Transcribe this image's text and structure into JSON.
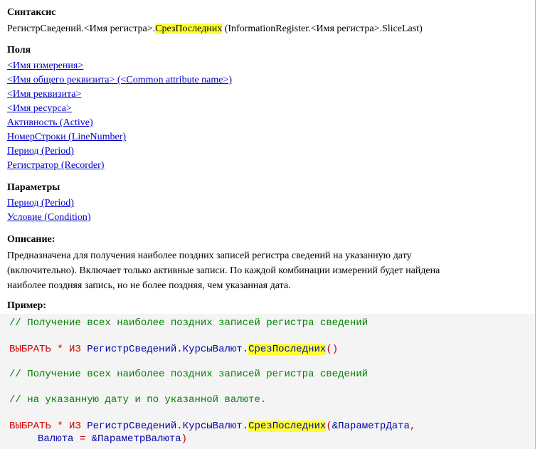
{
  "syntax": {
    "heading": "Синтаксис",
    "prefix": "РегистрСведений.<Имя регистра>.",
    "method": "СрезПоследних",
    "suffix": " (InformationRegister.<Имя регистра>.SliceLast)"
  },
  "fields": {
    "heading": "Поля",
    "items": [
      "<Имя измерения>",
      "<Имя общего реквизита> (<Common attribute name>)",
      "<Имя реквизита>",
      "<Имя ресурса>",
      "Активность (Active)",
      "НомерСтроки (LineNumber)",
      "Период (Period)",
      "Регистратор (Recorder)"
    ]
  },
  "params": {
    "heading": "Параметры",
    "items": [
      "Период (Period)",
      "Условие (Condition)"
    ]
  },
  "description": {
    "heading": "Описание:",
    "line1": "Предназначена для получения наиболее поздних записей регистра сведений на указанную дату",
    "line2": "(включительно). Включает только активные записи. По каждой комбинации измерений будет найдена",
    "line3": "наиболее поздняя запись, но не более поздняя, чем указанная дата."
  },
  "example": {
    "heading": "Пример:",
    "comment1": "// Получение всех наиболее поздних записей регистра сведений",
    "q1_kw": "ВЫБРАТЬ",
    "q1_star": " * ",
    "q1_from": "ИЗ",
    "q1_path": " РегистрСведений.КурсыВалют.",
    "q1_method": "СрезПоследних",
    "q1_paren": "()",
    "comment2": "// Получение всех наиболее поздних записей регистра сведений",
    "comment3": "// на указанную дату и по указанной валюте.",
    "q2_kw": "ВЫБРАТЬ",
    "q2_star": " * ",
    "q2_from": "ИЗ",
    "q2_path": " РегистрСведений.КурсыВалют.",
    "q2_method": "СрезПоследних",
    "q2_open": "(",
    "q2_arg1": "&ПараметрДата",
    "q2_comma": ",",
    "q2_arg2a": "Валюта",
    "q2_eq": " = ",
    "q2_arg2b": "&ПараметрВалюта",
    "q2_close": ")"
  },
  "colors": {
    "link": "#0000cc",
    "highlight": "#ffff33",
    "comment": "#008000",
    "keyword": "#cc0000",
    "identifier": "#0000aa",
    "code_bg": "#f4f4f4"
  }
}
